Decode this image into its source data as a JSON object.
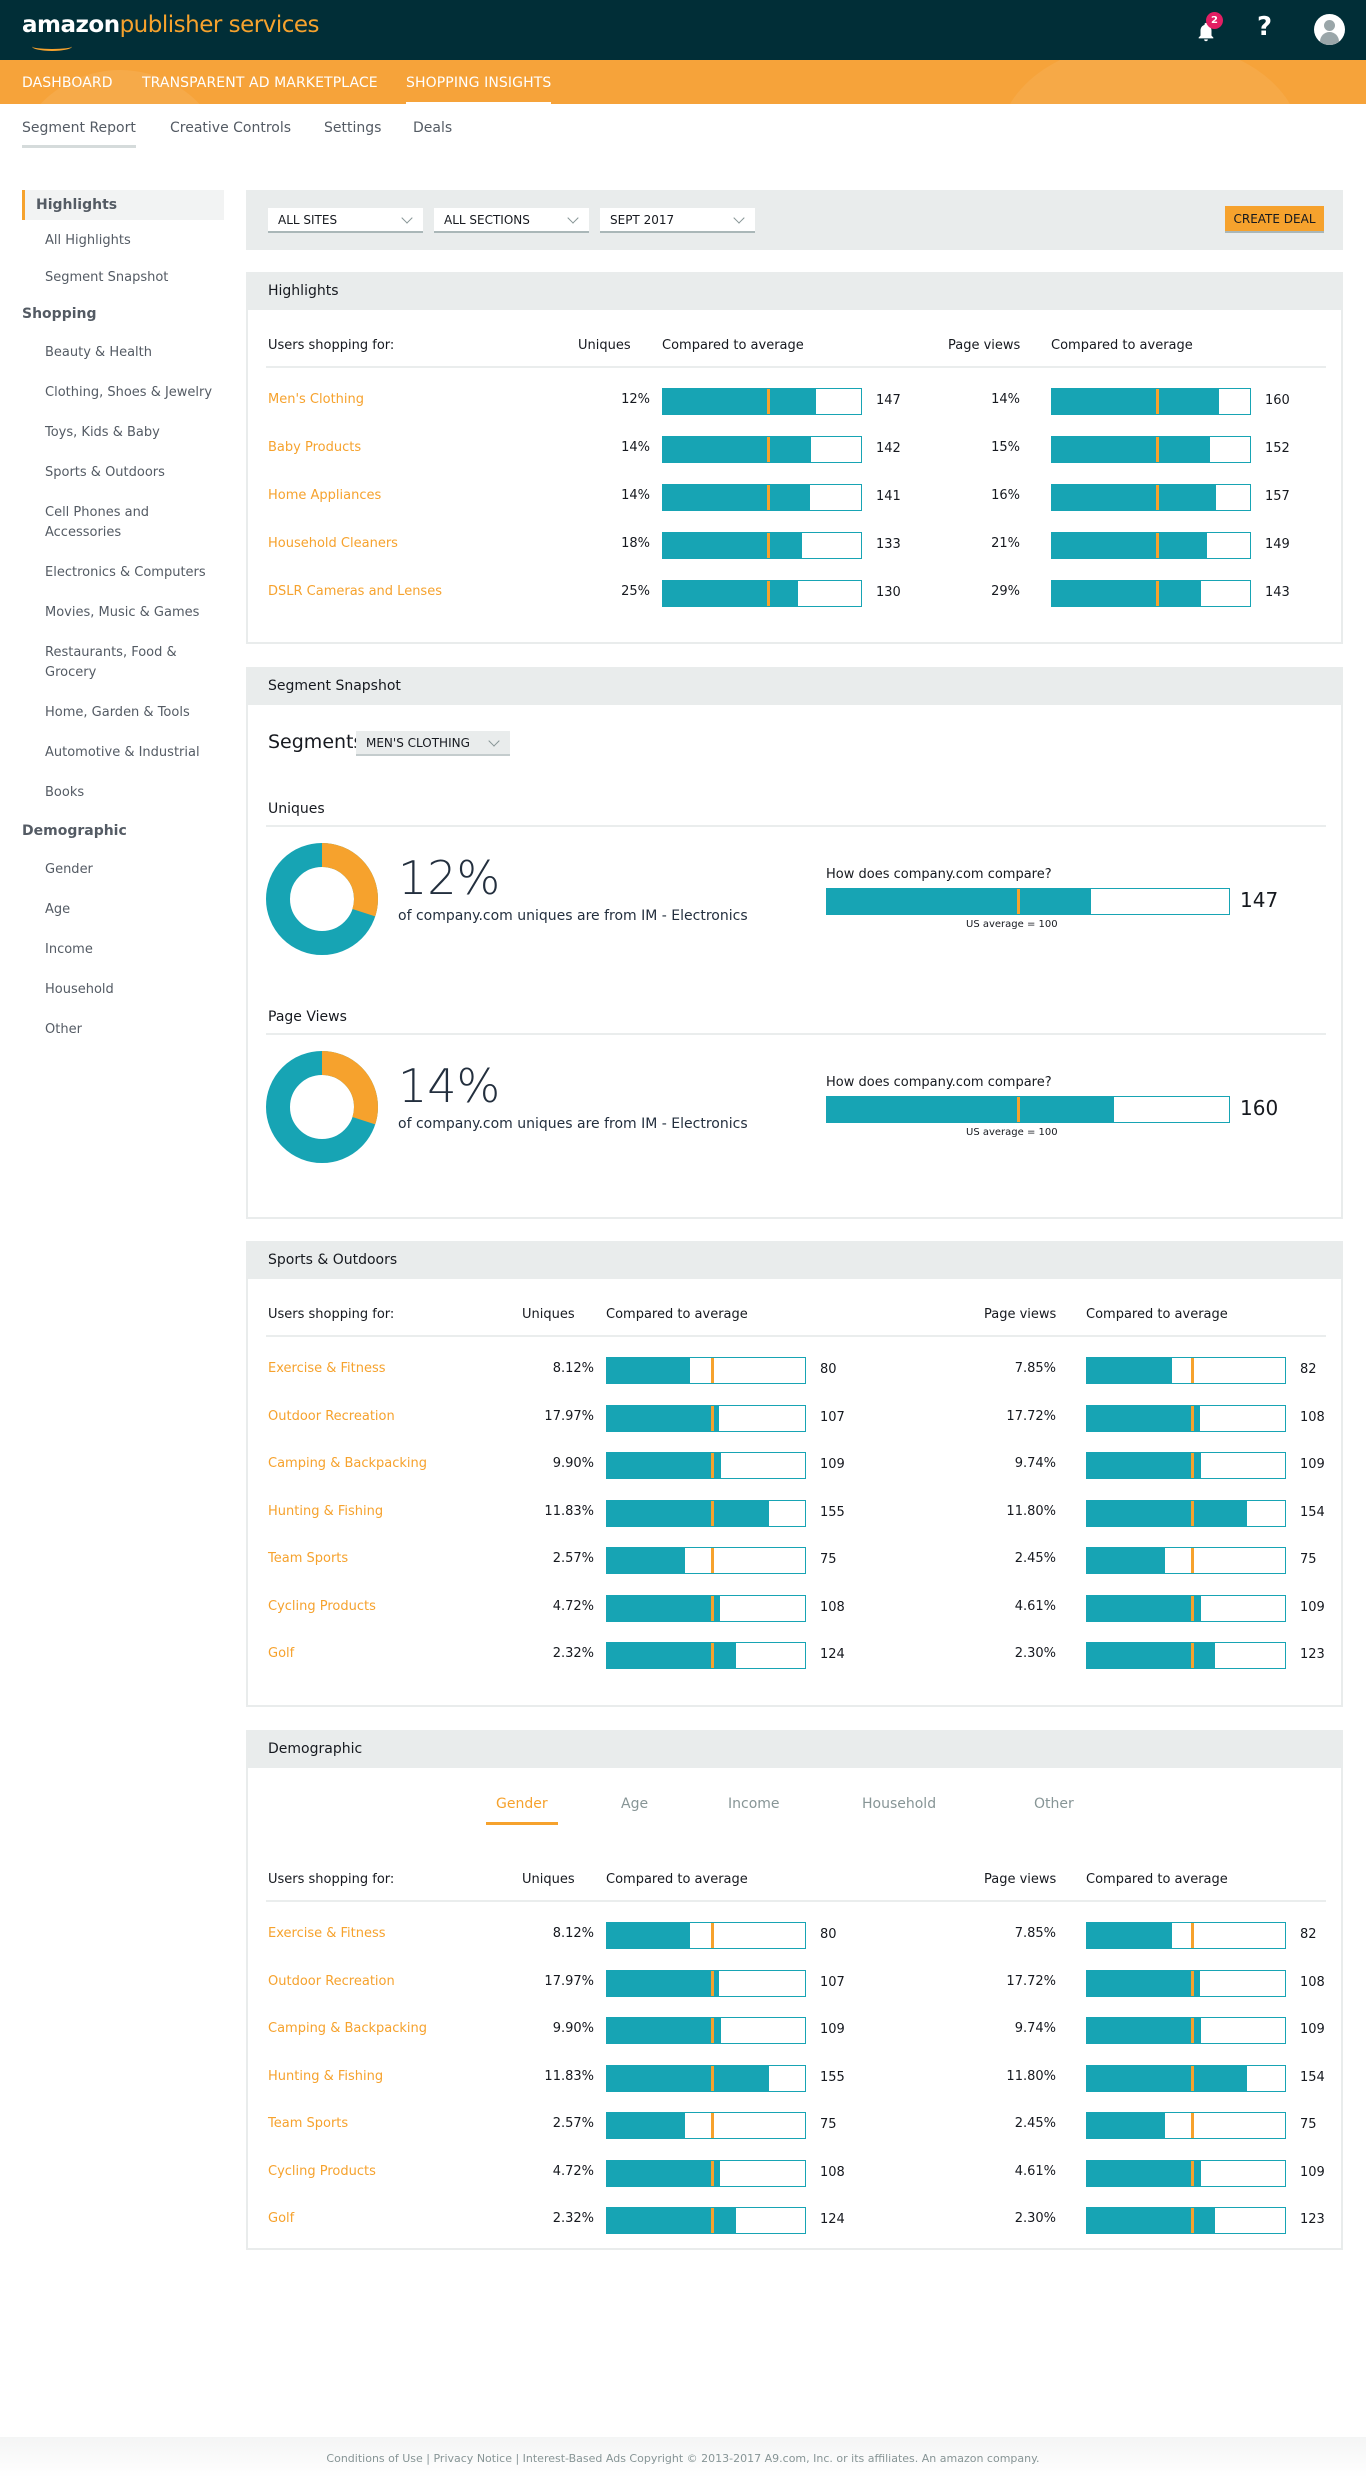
{
  "header": {
    "logo_brand": "amazon",
    "logo_product": "publisher services",
    "notifications_count": "2",
    "help_label": "?"
  },
  "nav": {
    "items": [
      {
        "label": "DASHBOARD"
      },
      {
        "label": "TRANSPARENT AD MARKETPLACE"
      },
      {
        "label": "SHOPPING INSIGHTS",
        "active": true
      }
    ]
  },
  "subnav": {
    "items": [
      {
        "label": "Segment Report",
        "active": true
      },
      {
        "label": "Creative Controls"
      },
      {
        "label": "Settings"
      },
      {
        "label": "Deals"
      }
    ]
  },
  "sidebar": {
    "sections": [
      {
        "heading": "Highlights",
        "items": [
          "All Highlights",
          "Segment Snapshot"
        ]
      },
      {
        "heading": "Shopping",
        "items": [
          "Beauty & Health",
          "Clothing, Shoes & Jewelry",
          "Toys, Kids & Baby",
          "Sports & Outdoors",
          "Cell Phones and Accessories",
          "Electronics & Computers",
          "Movies, Music & Games",
          "Restaurants, Food & Grocery",
          "Home, Garden & Tools",
          "Automotive & Industrial",
          "Books"
        ]
      },
      {
        "heading": "Demographic",
        "items": [
          "Gender",
          "Age",
          "Income",
          "Household",
          "Other"
        ]
      }
    ]
  },
  "filters": {
    "sites": "ALL SITES",
    "sections": "ALL SECTIONS",
    "period": "SEPT 2017",
    "create_deal": "CREATE DEAL"
  },
  "colors": {
    "accent": "#f6a22d",
    "bar": "#17a4b4",
    "header_bg": "#012e37",
    "nav_bg": "#f6a33a"
  },
  "table_headers": {
    "users": "Users shopping for:",
    "uniques": "Uniques",
    "compared": "Compared to average",
    "page_views": "Page views"
  },
  "highlights": {
    "title": "Highlights",
    "rows": [
      {
        "label": "Men's Clothing",
        "uniques": "12%",
        "uniques_index": 147,
        "page_views": "14%",
        "pv_index": 160
      },
      {
        "label": "Baby Products",
        "uniques": "14%",
        "uniques_index": 142,
        "page_views": "15%",
        "pv_index": 152
      },
      {
        "label": "Home Appliances",
        "uniques": "14%",
        "uniques_index": 141,
        "page_views": "16%",
        "pv_index": 157
      },
      {
        "label": "Household Cleaners",
        "uniques": "18%",
        "uniques_index": 133,
        "page_views": "21%",
        "pv_index": 149
      },
      {
        "label": "DSLR Cameras and Lenses",
        "uniques": "25%",
        "uniques_index": 130,
        "page_views": "29%",
        "pv_index": 143
      }
    ]
  },
  "snapshot": {
    "title": "Segment Snapshot",
    "segments_label": "Segments",
    "segment_value": "MEN'S CLOTHING",
    "blocks": [
      {
        "title": "Uniques",
        "pct": "12%",
        "desc": "of company.com uniques are from IM - Electronics",
        "question": "How does company.com compare?",
        "index": 147,
        "avg_label": "US average = 100",
        "donut_fraction": 0.3
      },
      {
        "title": "Page Views",
        "pct": "14%",
        "desc": "of company.com uniques are from IM - Electronics",
        "question": "How does company.com compare?",
        "index": 160,
        "avg_label": "US average = 100",
        "donut_fraction": 0.3
      }
    ]
  },
  "sports": {
    "title": "Sports & Outdoors",
    "rows": [
      {
        "label": "Exercise & Fitness",
        "uniques": "8.12%",
        "uniques_index": 80,
        "page_views": "7.85%",
        "pv_index": 82
      },
      {
        "label": "Outdoor Recreation",
        "uniques": "17.97%",
        "uniques_index": 107,
        "page_views": "17.72%",
        "pv_index": 108
      },
      {
        "label": "Camping & Backpacking",
        "uniques": "9.90%",
        "uniques_index": 109,
        "page_views": "9.74%",
        "pv_index": 109
      },
      {
        "label": "Hunting & Fishing",
        "uniques": "11.83%",
        "uniques_index": 155,
        "page_views": "11.80%",
        "pv_index": 154
      },
      {
        "label": "Team Sports",
        "uniques": "2.57%",
        "uniques_index": 75,
        "page_views": "2.45%",
        "pv_index": 75
      },
      {
        "label": "Cycling Products",
        "uniques": "4.72%",
        "uniques_index": 108,
        "page_views": "4.61%",
        "pv_index": 109
      },
      {
        "label": "Golf",
        "uniques": "2.32%",
        "uniques_index": 124,
        "page_views": "2.30%",
        "pv_index": 123
      }
    ]
  },
  "demographic": {
    "title": "Demographic",
    "tabs": [
      {
        "label": "Gender",
        "active": true
      },
      {
        "label": "Age"
      },
      {
        "label": "Income"
      },
      {
        "label": "Household"
      },
      {
        "label": "Other"
      }
    ],
    "rows": [
      {
        "label": "Exercise & Fitness",
        "uniques": "8.12%",
        "uniques_index": 80,
        "page_views": "7.85%",
        "pv_index": 82
      },
      {
        "label": "Outdoor Recreation",
        "uniques": "17.97%",
        "uniques_index": 107,
        "page_views": "17.72%",
        "pv_index": 108
      },
      {
        "label": "Camping & Backpacking",
        "uniques": "9.90%",
        "uniques_index": 109,
        "page_views": "9.74%",
        "pv_index": 109
      },
      {
        "label": "Hunting & Fishing",
        "uniques": "11.83%",
        "uniques_index": 155,
        "page_views": "11.80%",
        "pv_index": 154
      },
      {
        "label": "Team Sports",
        "uniques": "2.57%",
        "uniques_index": 75,
        "page_views": "2.45%",
        "pv_index": 75
      },
      {
        "label": "Cycling Products",
        "uniques": "4.72%",
        "uniques_index": 108,
        "page_views": "4.61%",
        "pv_index": 109
      },
      {
        "label": "Golf",
        "uniques": "2.32%",
        "uniques_index": 124,
        "page_views": "2.30%",
        "pv_index": 123
      }
    ]
  },
  "footer": {
    "text": "Conditions of Use | Privacy Notice | Interest-Based Ads  Copyright © 2013-2017 A9.com, Inc. or its affiliates. An amazon company."
  }
}
